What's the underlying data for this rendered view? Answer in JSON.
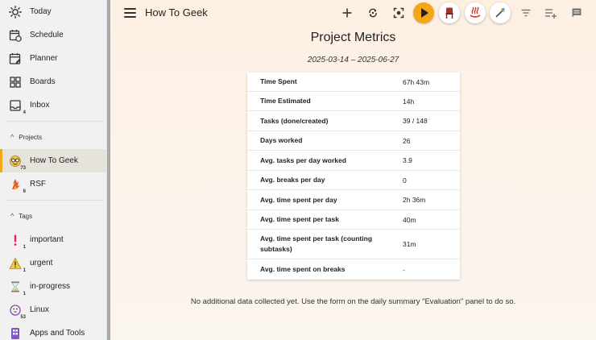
{
  "sidebar": {
    "main_items": [
      {
        "label": "Today",
        "icon": "sun-icon"
      },
      {
        "label": "Schedule",
        "icon": "calendar-clock-icon"
      },
      {
        "label": "Planner",
        "icon": "calendar-edit-icon"
      },
      {
        "label": "Boards",
        "icon": "grid-icon"
      },
      {
        "label": "Inbox",
        "icon": "inbox-icon",
        "badge": "4"
      }
    ],
    "projects_header": "Projects",
    "projects": [
      {
        "label": "How To Geek",
        "icon": "nerd-face-icon",
        "badge": "73",
        "active": true
      },
      {
        "label": "RSF",
        "icon": "fire-arrows-icon",
        "badge": "6"
      }
    ],
    "tags_header": "Tags",
    "tags": [
      {
        "label": "important",
        "icon": "exclamation-icon",
        "badge": "1"
      },
      {
        "label": "urgent",
        "icon": "warning-icon",
        "badge": "1"
      },
      {
        "label": "in-progress",
        "icon": "hourglass-icon",
        "badge": "1"
      },
      {
        "label": "Linux",
        "icon": "penguin-icon",
        "badge": "53"
      },
      {
        "label": "Apps and Tools",
        "icon": "apps-icon"
      }
    ]
  },
  "header": {
    "title": "How To Geek",
    "accent_color": "#f5a518"
  },
  "metrics": {
    "title": "Project Metrics",
    "date_range": "2025-03-14 – 2025-06-27",
    "rows": [
      {
        "label": "Time Spent",
        "value": "67h 43m"
      },
      {
        "label": "Time Estimated",
        "value": "14h"
      },
      {
        "label": "Tasks (done/created)",
        "value": "39 / 148"
      },
      {
        "label": "Days worked",
        "value": "26"
      },
      {
        "label": "Avg. tasks per day worked",
        "value": "3.9"
      },
      {
        "label": "Avg. breaks per day",
        "value": "0"
      },
      {
        "label": "Avg. time spent per day",
        "value": "2h 36m"
      },
      {
        "label": "Avg. time spent per task",
        "value": "40m"
      },
      {
        "label": "Avg. time spent per task (counting subtasks)",
        "value": "31m"
      },
      {
        "label": "Avg. time spent on breaks",
        "value": "-"
      }
    ],
    "footer_note": "No additional data collected yet. Use the form on the daily summary \"Evaluation\" panel to do so."
  }
}
